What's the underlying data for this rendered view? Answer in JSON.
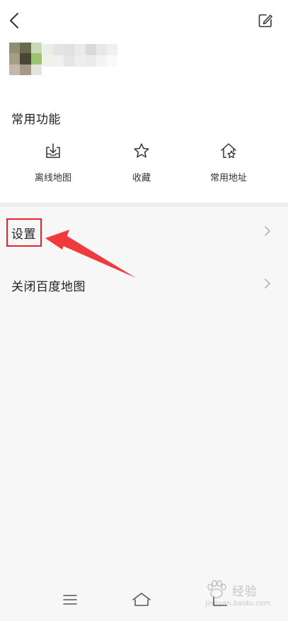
{
  "header": {
    "back_icon": "chevron-left-icon",
    "edit_icon": "edit-icon"
  },
  "profile": {
    "avatar_colors": [
      "#8f8f73",
      "#6c6a4c",
      "#c9d9b5",
      "#a39f86",
      "#4a4634",
      "#9bc26f",
      "#c4b8ae",
      "#a89888",
      "#e6e2dd"
    ],
    "name_colors": [
      "#e9efe4",
      "#e4e4e4",
      "#e1e1e1",
      "#eaeaea",
      "#d9d9d9",
      "#e8e8e8",
      "#f0f0f0",
      "#eef1ec",
      "#f1f1f1",
      "#e6e6e6",
      "#eeeeee",
      "#ebebeb",
      "#f4f4f4",
      "#fafafa"
    ]
  },
  "common": {
    "title": "常用功能",
    "items": [
      {
        "label": "离线地图",
        "icon": "download-tray-icon"
      },
      {
        "label": "收藏",
        "icon": "star-icon"
      },
      {
        "label": "常用地址",
        "icon": "home-star-icon"
      }
    ]
  },
  "menu": {
    "settings_label": "设置",
    "close_label": "关闭百度地图"
  },
  "annotation": {
    "box_color": "#e3252b",
    "arrow_color": "#ef3b3b"
  },
  "watermark": {
    "text": "经验",
    "sub": "jingyan.baidu.com"
  },
  "nav": {
    "menu_icon": "menu-lines-icon",
    "home_icon": "home-outline-icon",
    "back_icon": "back-square-icon"
  }
}
